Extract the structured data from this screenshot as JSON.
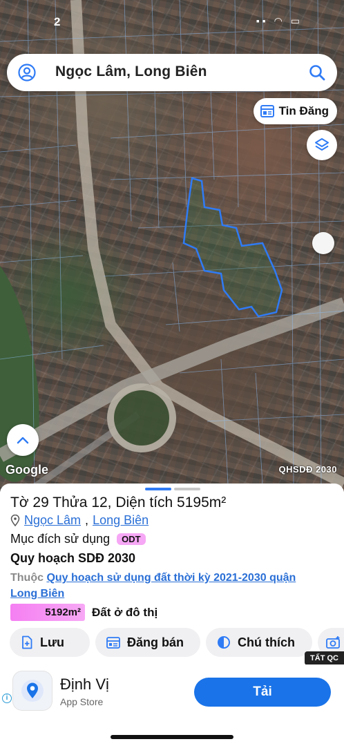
{
  "status_bar": {
    "time": "2",
    "icons": "▪▪ ◠ ▭"
  },
  "search": {
    "title": "Ngọc Lâm, Long Biên"
  },
  "map": {
    "tin_dang_label": "Tin Đăng",
    "google_logo": "Google",
    "layer_badge": "QHSDĐ 2030",
    "parcel_outline_color": "#2f7bf5"
  },
  "parcel": {
    "title": "Tờ 29 Thửa 12, Diện tích 5195m²",
    "ward": "Ngọc Lâm",
    "district": "Long Biên",
    "separator": ",",
    "purpose_label": "Mục đích sử dụng",
    "purpose_code": "ODT",
    "plan_title": "Quy hoạch SDĐ 2030",
    "plan_prefix": "Thuộc",
    "plan_link": "Quy hoạch sử dụng đất thời kỳ 2021-2030 quận Long Biên",
    "area_value": "5192m²",
    "area_label": "Đất ở đô thị",
    "accent_color": "#f57ff2"
  },
  "actions": [
    {
      "label": "Lưu",
      "icon": "bookmark-plus-icon"
    },
    {
      "label": "Đăng bán",
      "icon": "calendar-icon"
    },
    {
      "label": "Chú thích",
      "icon": "half-circle-icon"
    },
    {
      "label": "",
      "icon": "camera-plus-icon"
    }
  ],
  "ad": {
    "tag": "TẤT QC",
    "app_name": "Định Vị",
    "store": "App Store",
    "install_label": "Tải",
    "button_color": "#1a73e8"
  }
}
